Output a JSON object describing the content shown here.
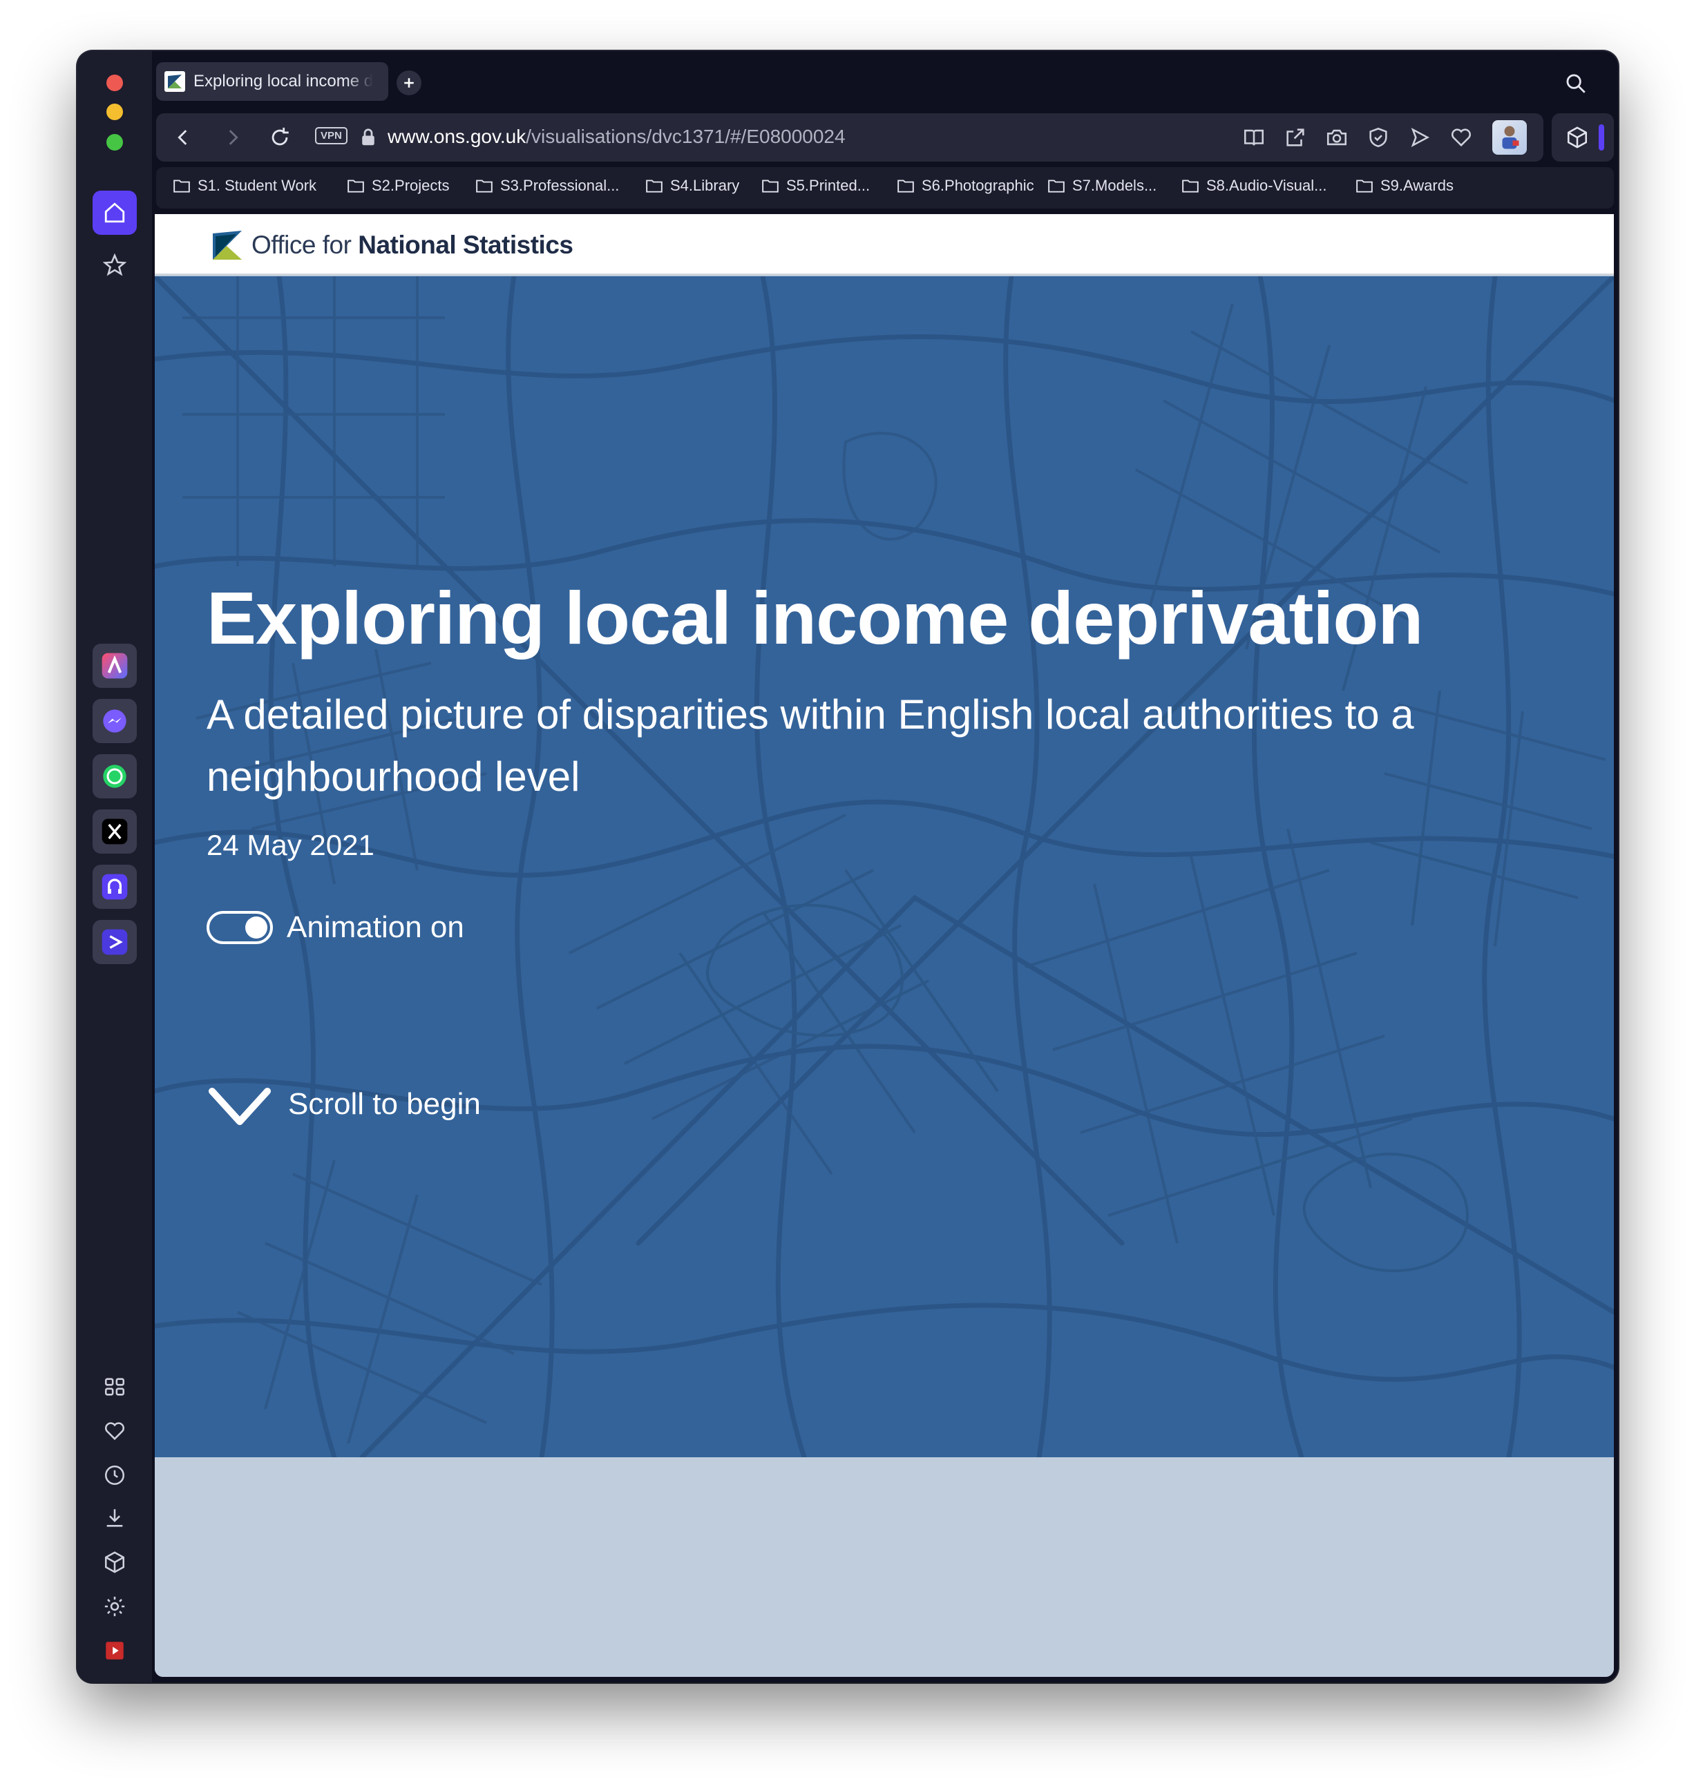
{
  "browser": {
    "tab_title": "Exploring local income d",
    "url_host": "www.ons.gov.uk",
    "url_path": "/visualisations/dvc1371/#/E08000024",
    "vpn_label": "VPN",
    "accent_color": "#5b3ff5"
  },
  "bookmarks": [
    "S1. Student Work",
    "S2.Projects",
    "S3.Professional...",
    "S4.Library",
    "S5.Printed...",
    "S6.Photographic",
    "S7.Models...",
    "S8.Audio-Visual...",
    "S9.Awards"
  ],
  "sidebar": {
    "top_icons": [
      "home-icon",
      "star-icon"
    ],
    "app_icons": [
      "aria-icon",
      "messenger-icon",
      "whatsapp-icon",
      "x-icon",
      "music-icon",
      "player-icon"
    ],
    "bottom_icons": [
      "grid-icon",
      "heart-icon",
      "clock-icon",
      "download-icon",
      "cube-icon",
      "settings-icon",
      "video-icon",
      "more-icon"
    ]
  },
  "site": {
    "logo_text_regular": "Office for ",
    "logo_text_bold": "National Statistics",
    "brand_color": "#34639a"
  },
  "hero": {
    "title": "Exploring local income deprivation",
    "subtitle": "A detailed picture of disparities within English local authorities to a neighbourhood level",
    "date": "24 May 2021",
    "toggle_label": "Animation on",
    "toggle_on": true,
    "scroll_label": "Scroll to begin"
  }
}
